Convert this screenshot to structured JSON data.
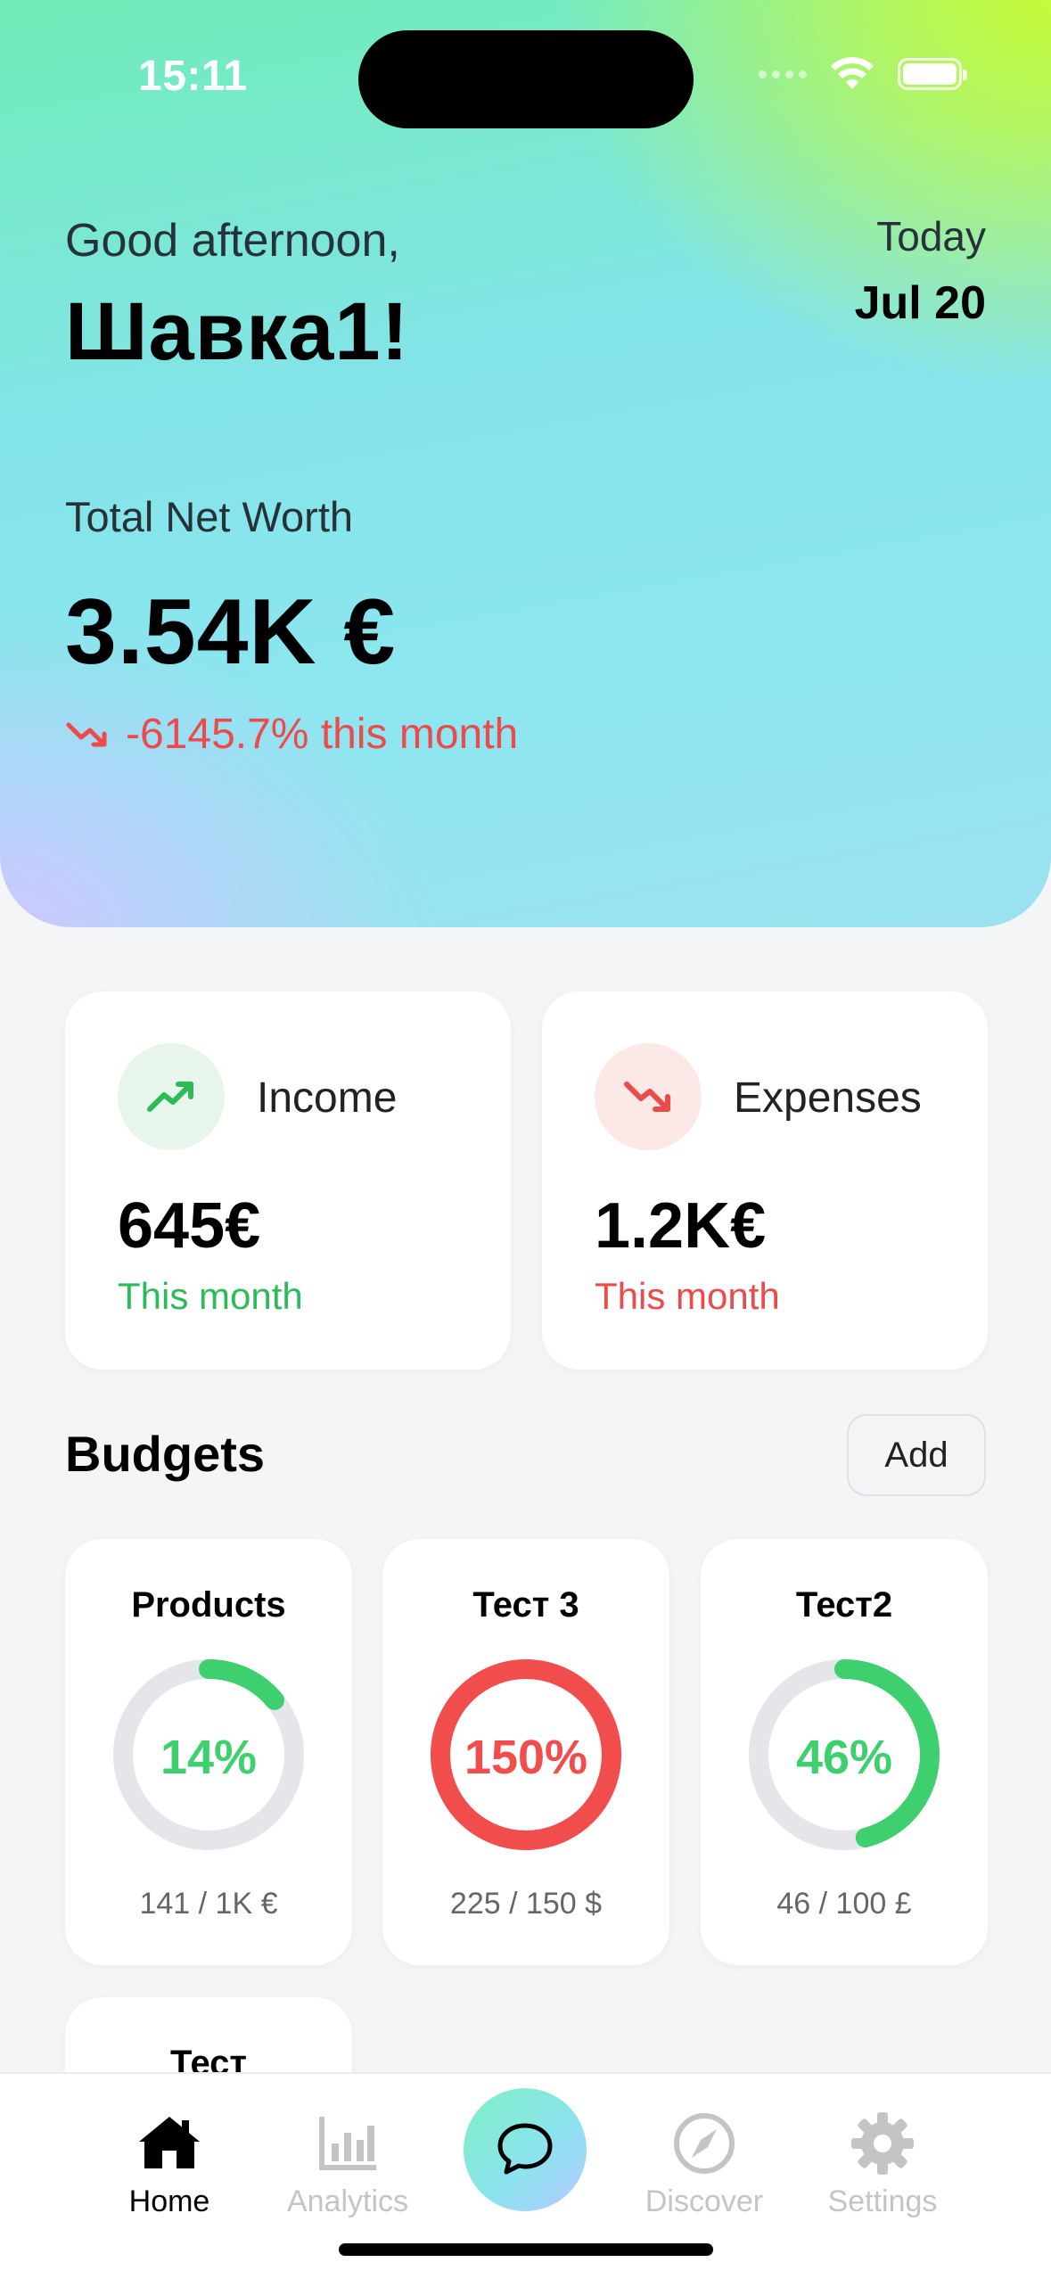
{
  "status_bar": {
    "time": "15:11"
  },
  "header": {
    "greeting": "Good afternoon,",
    "user_name": "Шавка1!",
    "today_label": "Today",
    "today_date": "Jul 20",
    "net_worth_label": "Total Net Worth",
    "net_worth_value": "3.54K €",
    "net_worth_change": "-6145.7% this month",
    "change_trend": "down"
  },
  "summary": {
    "income": {
      "title": "Income",
      "value": "645€",
      "subtitle": "This month",
      "icon": "trend-up-icon"
    },
    "expenses": {
      "title": "Expenses",
      "value": "1.2K€",
      "subtitle": "This month",
      "icon": "trend-down-icon"
    }
  },
  "budgets": {
    "title": "Budgets",
    "add_label": "Add",
    "items": [
      {
        "name": "Products",
        "percent_label": "14%",
        "progress": 0.14,
        "amount": "141 / 1K €",
        "status": "ok"
      },
      {
        "name": "Тест 3",
        "percent_label": "150%",
        "progress": 1.5,
        "amount": "225 / 150 $",
        "status": "over"
      },
      {
        "name": "Тест2",
        "percent_label": "46%",
        "progress": 0.46,
        "amount": "46 / 100 £",
        "status": "ok"
      },
      {
        "name": "Тест"
      }
    ]
  },
  "tabbar": {
    "home": "Home",
    "analytics": "Analytics",
    "chat_icon": "chat-bubble-icon",
    "discover": "Discover",
    "settings": "Settings"
  },
  "colors": {
    "positive": "#2dbb5a",
    "negative": "#ec4b4b",
    "ring_track": "#e6e6ea",
    "ring_ok": "#3ecf6e",
    "ring_over": "#f24d4d"
  }
}
